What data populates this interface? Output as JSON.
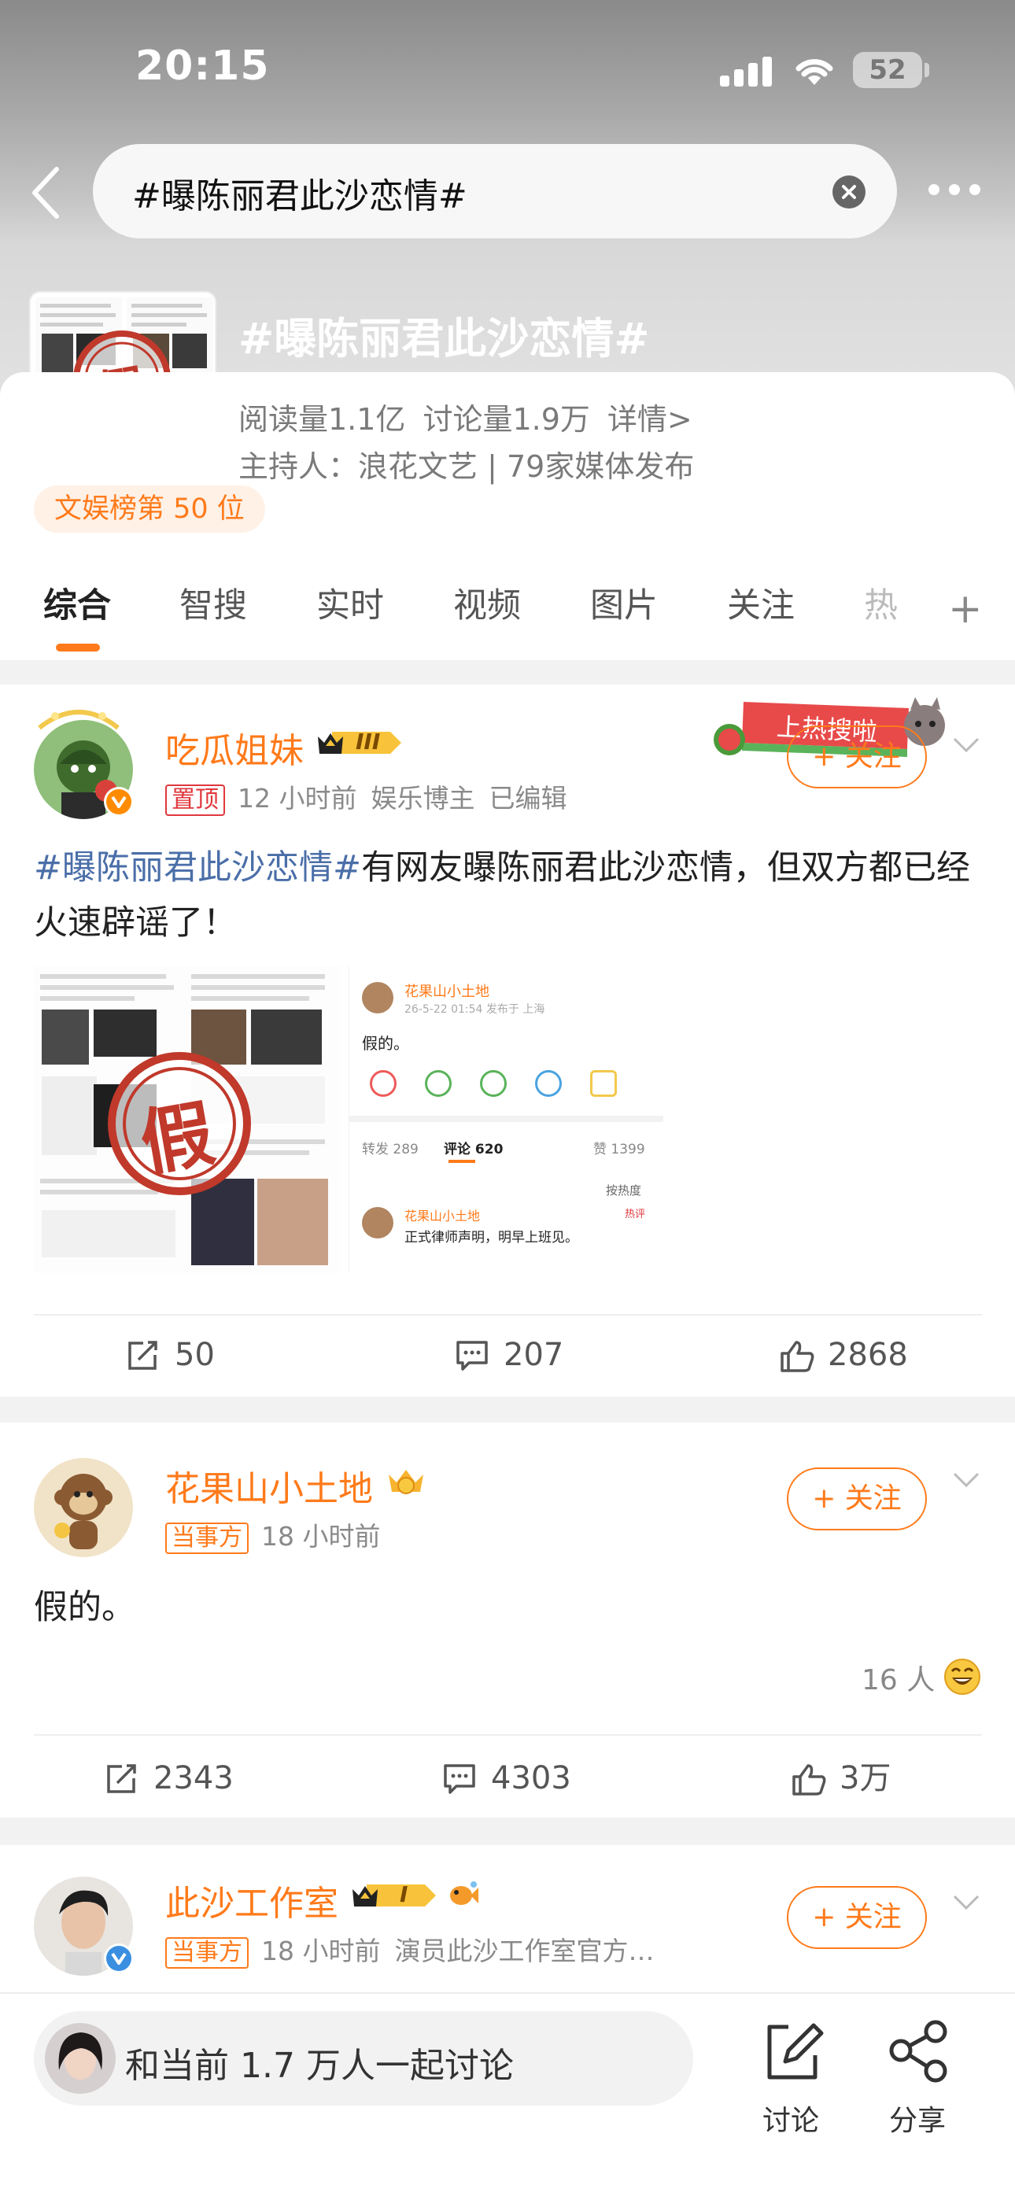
{
  "status_bar": {
    "time": "20:15",
    "battery": "52"
  },
  "search": {
    "query": "#曝陈丽君此沙恋情#"
  },
  "topic": {
    "title": "#曝陈丽君此沙恋情#",
    "reads": "阅读量1.1亿",
    "discussions": "讨论量1.9万",
    "details_link": "详情>",
    "host": "主持人：浪花文艺 | 79家媒体发布",
    "rank": "文娱榜第 50 位",
    "thumb_stamp": "假"
  },
  "tabs": [
    "综合",
    "智搜",
    "实时",
    "视频",
    "图片",
    "关注",
    "热"
  ],
  "follow_label": "+ 关注",
  "posts": [
    {
      "author": "吃瓜姐妹",
      "vip_level": "III",
      "pinned_tag": "置顶",
      "time": "12 小时前",
      "source": "娱乐博主",
      "edited": "已编辑",
      "hashtag": "#曝陈丽君此沙恋情#",
      "text": "有网友曝陈丽君此沙恋情，但双方都已经火速辟谣了！",
      "image_stamp": "假",
      "sticker_text": "上热搜啦",
      "screenshot": {
        "author": "花果山小土地",
        "meta": "26-5-22 01:54  发布于 上海",
        "text": "假的。",
        "repost_tab": "转发 289",
        "comment_tab": "评论 620",
        "like_tab": "赞 1399",
        "sort": "按热度",
        "reply_author": "花果山小土地",
        "reply_text": "正式律师声明，明早上班见。",
        "reply_badge": "热评"
      },
      "reposts": "50",
      "comments": "207",
      "likes": "2868"
    },
    {
      "author": "花果山小土地",
      "party_tag": "当事方",
      "time": "18 小时前",
      "text": "假的。",
      "reactions": "16 人",
      "reposts": "2343",
      "comments": "4303",
      "likes": "3万"
    },
    {
      "author": "此沙工作室",
      "vip_level": "I",
      "party_tag": "当事方",
      "time": "18 小时前",
      "source": "演员此沙工作室官方…"
    }
  ],
  "bottom_bar": {
    "discuss_text": "和当前 1.7 万人一起讨论",
    "discuss_label": "讨论",
    "share_label": "分享"
  },
  "colors": {
    "accent": "#ff7a1a",
    "hashtag": "#4a6ea8",
    "verified": "#ff8c00"
  }
}
